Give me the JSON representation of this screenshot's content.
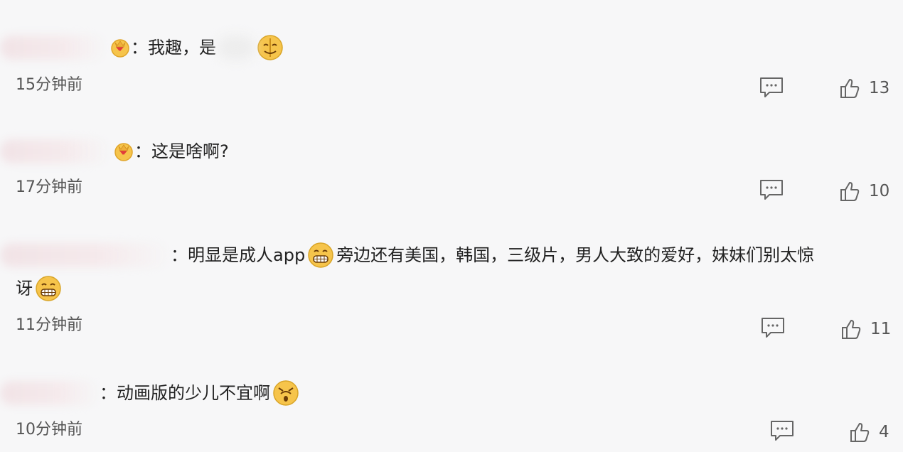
{
  "comments": [
    {
      "text_before": "：我趣，是",
      "text_after": "",
      "emoji_after": "smirk-emoji",
      "time": "15分钟前",
      "likes": "13"
    },
    {
      "text_before": "：这是啥啊?",
      "text_after": "",
      "time": "17分钟前",
      "likes": "10"
    },
    {
      "text_before": "：明显是成人app",
      "text_mid": "旁边还有美国，韩国，三级片，男人大致的爱好，妹妹们别太惊",
      "text_line2": "讶",
      "time": "11分钟前",
      "likes": "11"
    },
    {
      "text_before": "：动画版的少儿不宜啊",
      "time": "10分钟前",
      "likes": "4"
    }
  ],
  "icons": {
    "badge": "heart-crown-icon",
    "reply": "comment-icon",
    "like": "thumbs-up-icon"
  },
  "colors": {
    "background": "#f7f7f8",
    "emoji_yellow": "#f6c44b",
    "icon_gray": "#666666"
  }
}
